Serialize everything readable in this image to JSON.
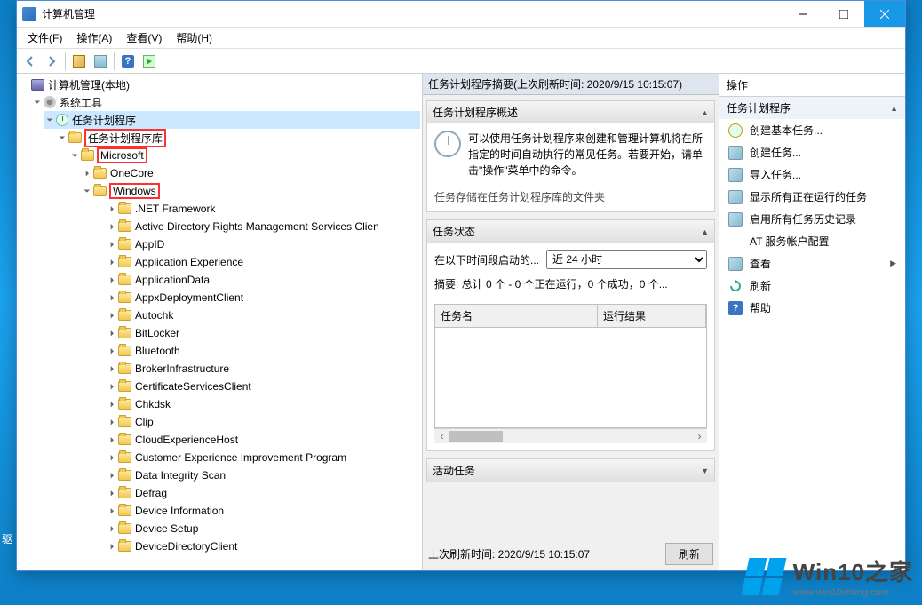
{
  "title": "计算机管理",
  "menubar": [
    "文件(F)",
    "操作(A)",
    "查看(V)",
    "帮助(H)"
  ],
  "tree": {
    "root": "计算机管理(本地)",
    "systools": "系统工具",
    "scheduler": "任务计划程序",
    "library": "任务计划程序库",
    "microsoft": "Microsoft",
    "onecore": "OneCore",
    "windows": "Windows",
    "items": [
      ".NET Framework",
      "Active Directory Rights Management Services Clien",
      "AppID",
      "Application Experience",
      "ApplicationData",
      "AppxDeploymentClient",
      "Autochk",
      "BitLocker",
      "Bluetooth",
      "BrokerInfrastructure",
      "CertificateServicesClient",
      "Chkdsk",
      "Clip",
      "CloudExperienceHost",
      "Customer Experience Improvement Program",
      "Data Integrity Scan",
      "Defrag",
      "Device Information",
      "Device Setup",
      "DeviceDirectoryClient"
    ]
  },
  "mid": {
    "headerPrefix": "任务计划程序摘要(上次刷新时间: ",
    "headerTime": "2020/9/15 10:15:07",
    "headerSuffix": ")",
    "overviewTitle": "任务计划程序概述",
    "overviewText": "可以使用任务计划程序来创建和管理计算机将在所指定的时间自动执行的常见任务。若要开始，请单击\"操作\"菜单中的命令。",
    "overviewText2": "任务存储在任务计划程序库的文件夹",
    "statusTitle": "任务状态",
    "statusLabel": "在以下时间段启动的...",
    "statusOptions": [
      "近 24 小时"
    ],
    "summary": "摘要: 总计 0 个 - 0 个正在运行，0 个成功，0 个...",
    "tableCol1": "任务名",
    "tableCol2": "运行结果",
    "activeTasksTitle": "活动任务",
    "footerLabel": "上次刷新时间: 2020/9/15 10:15:07",
    "refreshBtn": "刷新"
  },
  "actions": {
    "paneTitle": "操作",
    "groupTitle": "任务计划程序",
    "items": [
      "创建基本任务...",
      "创建任务...",
      "导入任务...",
      "显示所有正在运行的任务",
      "启用所有任务历史记录",
      "AT 服务帐户配置",
      "查看",
      "刷新",
      "帮助"
    ]
  },
  "watermark": {
    "brand": "Win10之家",
    "url": "www.win10xitong.com"
  },
  "desktop": {
    "driverLabel": "驱"
  }
}
